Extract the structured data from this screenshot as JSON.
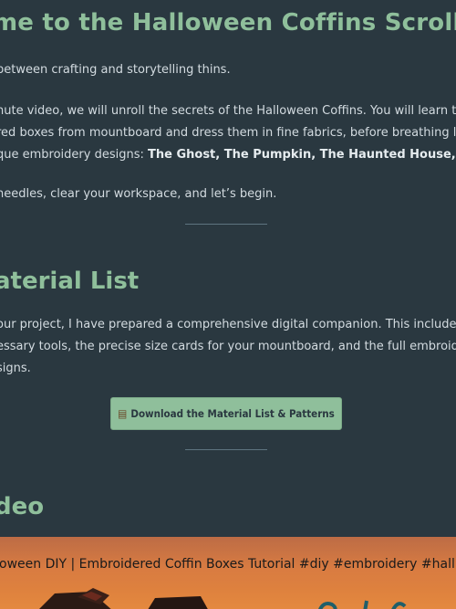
{
  "sections": {
    "welcome": {
      "title": "me to the Halloween Coffins Scroll",
      "line1": "between crafting and storytelling thins.",
      "line2": "nute video, we will unroll the secrets of the Halloween Coffins. You will learn to",
      "line3": "red boxes from mountboard and dress them in fine fabrics, before breathing lif",
      "line4_pre": "que embroidery designs: ",
      "line4_bold": "The Ghost, The Pumpkin, The Haunted House, and",
      "line5": "needles, clear your workspace, and let’s begin."
    },
    "materials": {
      "title": "aterial List",
      "line1": "our project, I have prepared a comprehensive digital companion. This includes",
      "line2": "essary tools, the precise size cards for your mountboard, and the full embroide",
      "line3": "signs.",
      "download_button": "Download the Material List & Patterns",
      "download_icon": "scroll-icon"
    },
    "video": {
      "title": "deo",
      "video_title": "oween DIY | Embroidered Coffin Boxes Tutorial #diy #embroidery #hall..."
    }
  },
  "colors": {
    "background": "#2a3840",
    "accent": "#8fbf9b",
    "text": "#d3dbe0"
  }
}
